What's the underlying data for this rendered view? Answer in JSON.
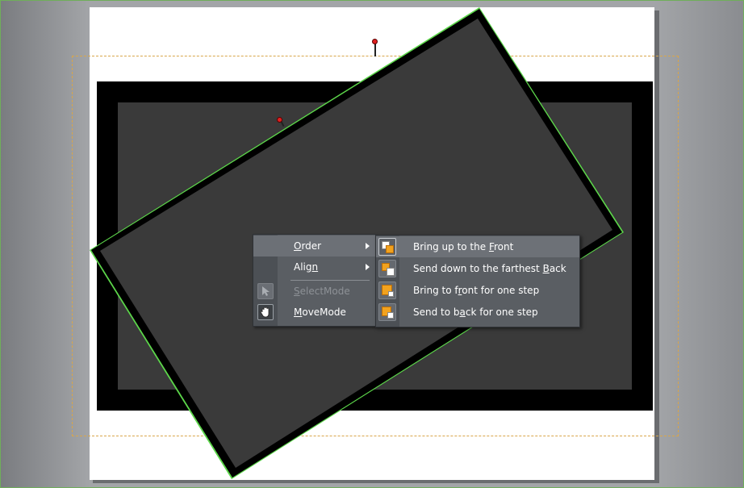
{
  "colors": {
    "frame_border": "#6fae5a",
    "guide": "#d9a64a",
    "selection_outline": "#5cd64a",
    "handle": "#e02020",
    "menu_bg": "#5a5e63",
    "menu_hover": "#6c7076",
    "icon_orange": "#f2a21e"
  },
  "context_menu": {
    "items": [
      {
        "label_pre": "",
        "label_key": "O",
        "label_post": "rder",
        "has_submenu": true,
        "hovered": true,
        "enabled": true
      },
      {
        "label_pre": "Alig",
        "label_key": "n",
        "label_post": "",
        "has_submenu": true,
        "hovered": false,
        "enabled": true
      },
      {
        "label_pre": "",
        "label_key": "S",
        "label_post": "electMode",
        "has_submenu": false,
        "hovered": false,
        "enabled": false,
        "icon": "arrow-pointer-icon"
      },
      {
        "label_pre": "",
        "label_key": "M",
        "label_post": "oveMode",
        "has_submenu": false,
        "hovered": false,
        "enabled": true,
        "icon": "hand-icon",
        "active": true
      }
    ]
  },
  "order_submenu": {
    "items": [
      {
        "label_pre": "Bring up to the ",
        "label_key": "F",
        "label_post": "ront",
        "icon": "bring-to-front-icon",
        "hovered": true
      },
      {
        "label_pre": "Send down to the farthest ",
        "label_key": "B",
        "label_post": "ack",
        "icon": "send-to-back-icon",
        "hovered": false
      },
      {
        "label_pre": "Bring to f",
        "label_key": "r",
        "label_post": "ont for one step",
        "icon": "bring-forward-icon",
        "hovered": false
      },
      {
        "label_pre": "Send to b",
        "label_key": "a",
        "label_post": "ck for one step",
        "icon": "send-backward-icon",
        "hovered": false
      }
    ]
  }
}
